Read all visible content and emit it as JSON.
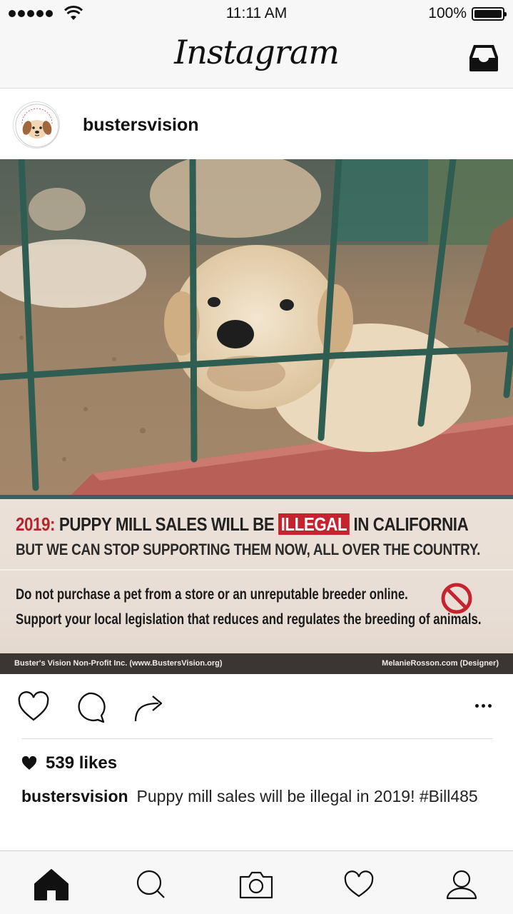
{
  "status_bar": {
    "time": "11:11 AM",
    "battery": "100%",
    "battery_level": 1.0,
    "icons": [
      "signal-dots-icon",
      "wifi-icon",
      "battery-icon"
    ]
  },
  "nav": {
    "title": "Instagram",
    "inbox_icon": "inbox-tray-icon"
  },
  "post": {
    "username": "bustersvision",
    "avatar_icon": "dog-face-logo",
    "avatar_text": "Buster's Vision Non-Profit",
    "image": {
      "description_icon": "puppy-behind-fence-photo",
      "headline_year": "2019:",
      "headline_pre": "PUPPY MILL SALES WILL BE",
      "headline_highlight": "ILLEGAL",
      "headline_post": "IN CALIFORNIA",
      "subheadline": "BUT WE CAN STOP SUPPORTING THEM NOW, ALL OVER THE COUNTRY.",
      "tip1": "Do not purchase a pet from a store or an unreputable breeder online.",
      "tip2": "Support your local legislation that reduces and regulates the breeding of animals.",
      "footer_left": "Buster's Vision Non-Profit Inc. (www.BustersVision.org)",
      "footer_right": "MelanieRosson.com (Designer)",
      "accent_red": "#c5232d",
      "accent_teal": "#3d5f5d"
    },
    "actions": [
      "heart-icon",
      "comment-icon",
      "share-icon",
      "more-icon"
    ],
    "likes": "539 likes",
    "caption_user": "bustersvision",
    "caption_text": "Puppy mill sales will be illegal in 2019! #Bill485"
  },
  "tab_bar": {
    "tabs": [
      "home-icon",
      "search-icon",
      "camera-icon",
      "activity-heart-icon",
      "profile-icon"
    ],
    "active": "home-icon"
  }
}
